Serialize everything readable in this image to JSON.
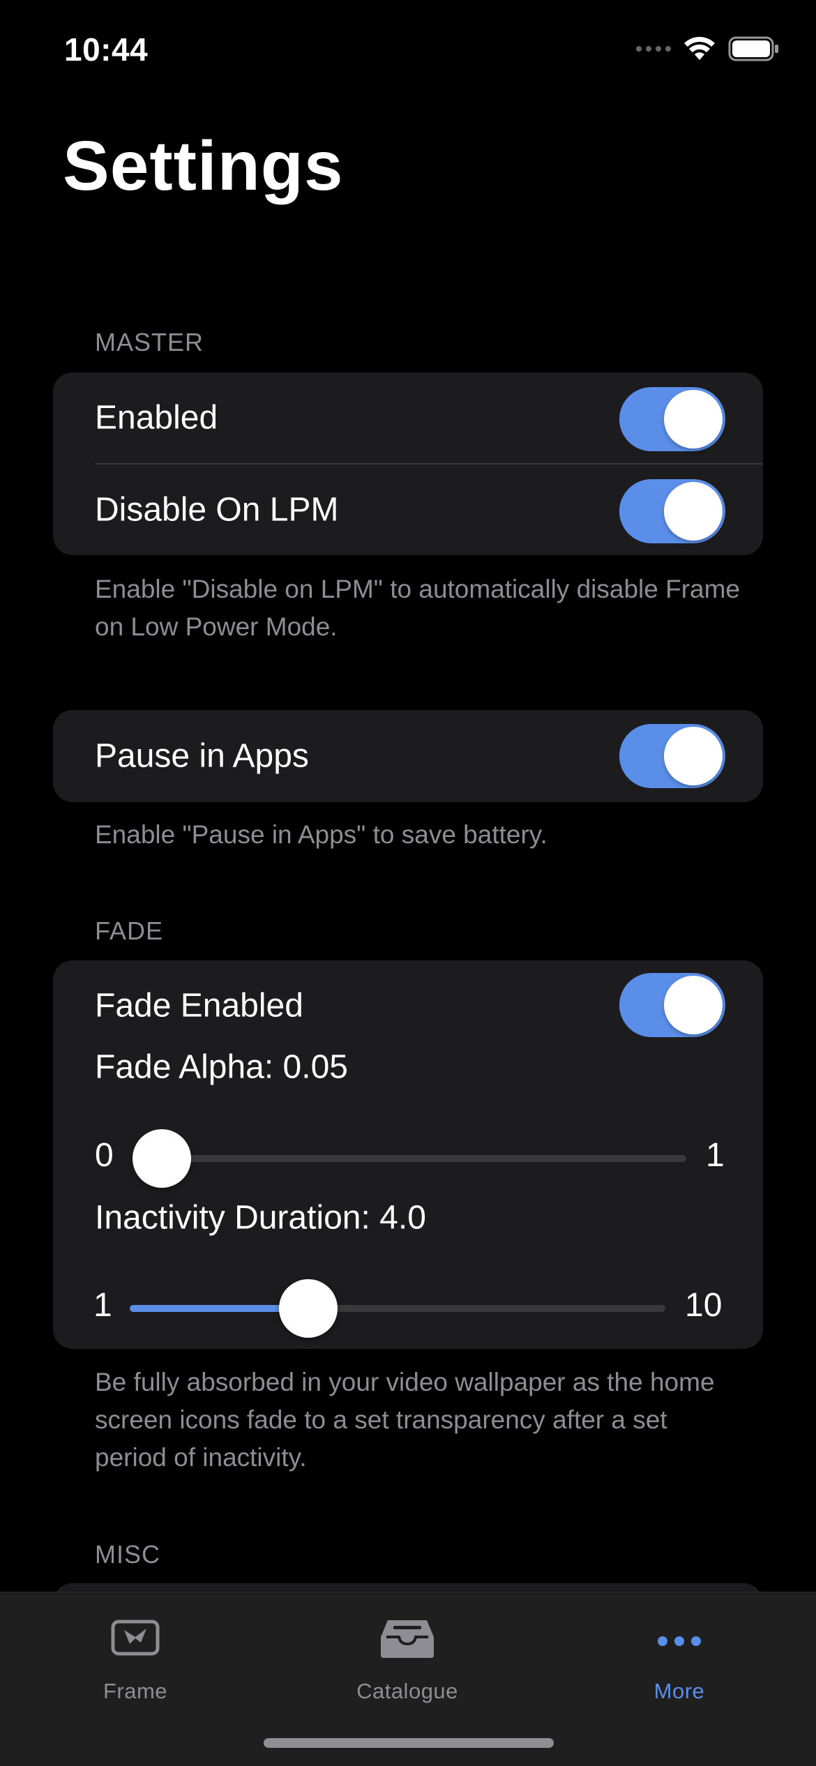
{
  "status_bar": {
    "time": "10:44"
  },
  "page": {
    "title": "Settings"
  },
  "sections": {
    "master": {
      "header": "MASTER",
      "enabled_label": "Enabled",
      "enabled_on": true,
      "disable_lpm_label": "Disable On LPM",
      "disable_lpm_on": true,
      "footer": "Enable \"Disable on LPM\" to automatically disable Frame on Low Power Mode."
    },
    "pause": {
      "label": "Pause in Apps",
      "on": true,
      "footer": "Enable \"Pause in Apps\" to save battery."
    },
    "fade": {
      "header": "FADE",
      "enabled_label": "Fade Enabled",
      "enabled_on": true,
      "alpha_label": "Fade Alpha: 0.05",
      "alpha_min": "0",
      "alpha_max": "1",
      "alpha_value": 0.05,
      "inactivity_label": "Inactivity Duration: 4.0",
      "inactivity_min": "1",
      "inactivity_max": "10",
      "inactivity_value": 4.0,
      "footer": "Be fully absorbed in your video wallpaper as the home screen icons fade to a set transparency after a set period of inactivity."
    },
    "misc": {
      "header": "MISC"
    }
  },
  "tabbar": {
    "tabs": [
      {
        "label": "Frame",
        "icon": "frame-icon",
        "active": false
      },
      {
        "label": "Catalogue",
        "icon": "tray-icon",
        "active": false
      },
      {
        "label": "More",
        "icon": "ellipsis-icon",
        "active": true
      }
    ]
  },
  "colors": {
    "accent": "#5a8ee8",
    "background": "#000000",
    "group_background": "#1c1c1e",
    "secondary_text": "#8d8d93"
  }
}
